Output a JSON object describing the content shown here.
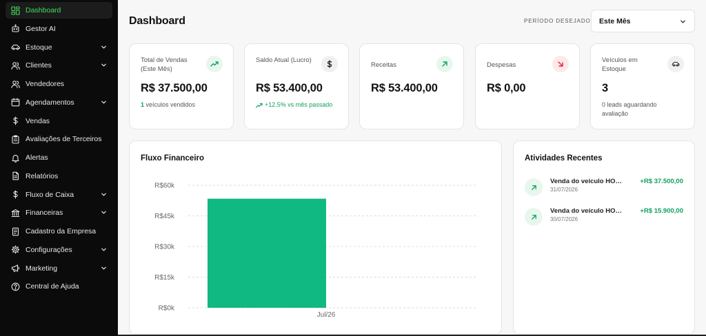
{
  "sidebar": {
    "items": [
      {
        "label": "Dashboard",
        "icon": "dashboard-icon",
        "active": true
      },
      {
        "label": "Gestor AI",
        "icon": "robot-icon"
      },
      {
        "label": "Estoque",
        "icon": "car-icon",
        "expandable": true
      },
      {
        "label": "Clientes",
        "icon": "users-icon",
        "expandable": true
      },
      {
        "label": "Vendedores",
        "icon": "user-group-icon"
      },
      {
        "label": "Agendamentos",
        "icon": "calendar-icon",
        "expandable": true
      },
      {
        "label": "Vendas",
        "icon": "dollar-icon"
      },
      {
        "label": "Avaliações de Terceiros",
        "icon": "clipboard-icon"
      },
      {
        "label": "Alertas",
        "icon": "bell-icon"
      },
      {
        "label": "Relatórios",
        "icon": "file-icon"
      },
      {
        "label": "Fluxo de Caixa",
        "icon": "dollar-icon",
        "expandable": true
      },
      {
        "label": "Financeiras",
        "icon": "bank-icon",
        "expandable": true
      },
      {
        "label": "Cadastro da Empresa",
        "icon": "document-icon"
      },
      {
        "label": "Configurações",
        "icon": "gear-icon",
        "expandable": true
      },
      {
        "label": "Marketing",
        "icon": "megaphone-icon",
        "expandable": true
      },
      {
        "label": "Central de Ajuda",
        "icon": "help-icon"
      }
    ]
  },
  "header": {
    "title": "Dashboard",
    "period_label": "PERÍODO DESEJADO:",
    "period_value": "Este Mês"
  },
  "cards": [
    {
      "label": "Total de Vendas (Este Mês)",
      "value": "R$ 37.500,00",
      "sub_num": "1",
      "sub_text": " veículos vendidos",
      "icon": "trending-up-icon"
    },
    {
      "label": "Saldo Atual (Lucro)",
      "value": "R$ 53.400,00",
      "sub_text": "+12.5% vs mês passado",
      "icon": "dollar-icon"
    },
    {
      "label": "Receitas",
      "value": "R$ 53.400,00",
      "icon": "arrow-up-right-icon"
    },
    {
      "label": "Despesas",
      "value": "R$ 0,00",
      "icon": "arrow-down-right-icon"
    },
    {
      "label": "Veículos em Estoque",
      "value": "3",
      "sub_text": "0 leads aguardando avaliação",
      "icon": "car-icon"
    }
  ],
  "colors": {
    "accent": "#10b981",
    "positive": "#10a060",
    "negative": "#e0263a",
    "sidebar_bg": "#0b0b0b",
    "active_text": "#3ee05a"
  },
  "chart_panel": {
    "title": "Fluxo Financeiro"
  },
  "chart_data": {
    "type": "bar",
    "categories": [
      "Jul/26"
    ],
    "values": [
      53400
    ],
    "ylim": [
      0,
      60000
    ],
    "yticks": [
      "R$0k",
      "R$15k",
      "R$30k",
      "R$45k",
      "R$60k"
    ],
    "ytick_values": [
      0,
      15000,
      30000,
      45000,
      60000
    ],
    "grid": true,
    "color": "#10b981"
  },
  "activities": {
    "title": "Atividades Recentes",
    "items": [
      {
        "title": "Venda do veículo HONDA",
        "date": "31/07/2026",
        "amount": "+R$ 37.500,00"
      },
      {
        "title": "Venda do veículo HONDA",
        "date": "30/07/2026",
        "amount": "+R$ 15.900,00"
      }
    ]
  }
}
